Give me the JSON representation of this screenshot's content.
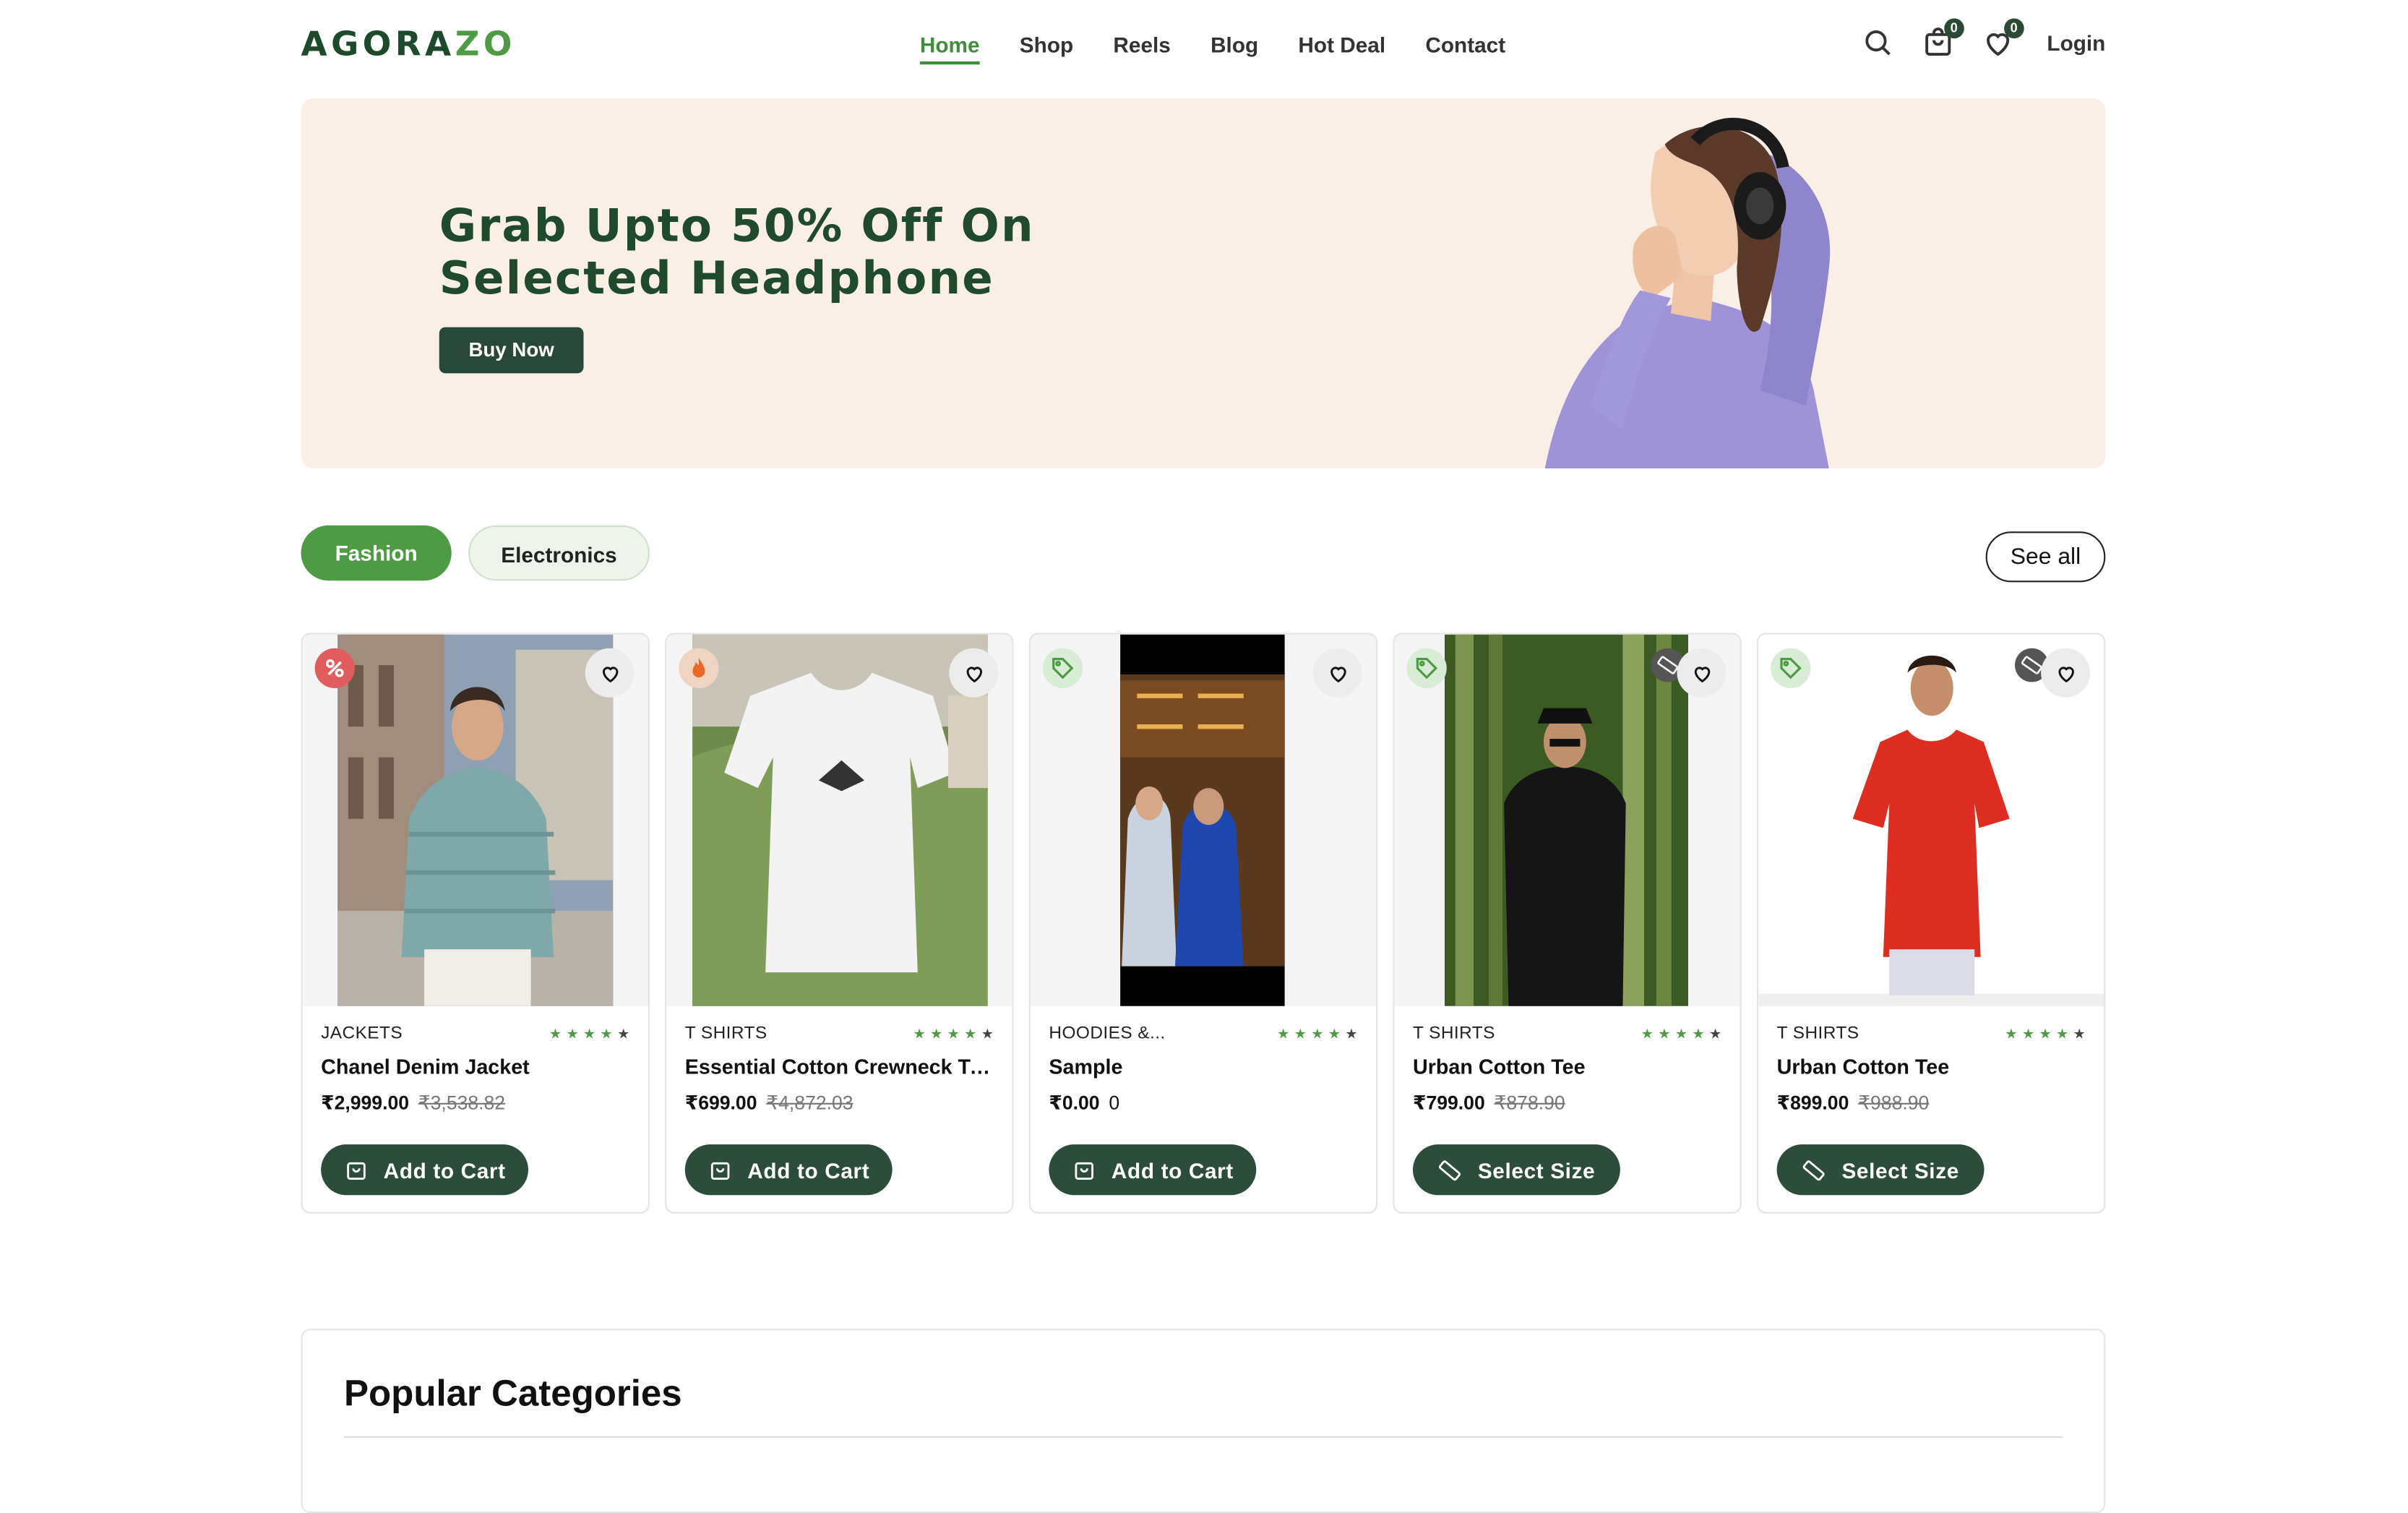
{
  "brand": {
    "logo_main": "AGORA",
    "logo_accent": "ZO",
    "primary_color": "#1e4a2c",
    "accent_color": "#4f9a44"
  },
  "nav": [
    {
      "label": "Home",
      "active": true
    },
    {
      "label": "Shop"
    },
    {
      "label": "Reels"
    },
    {
      "label": "Blog"
    },
    {
      "label": "Hot Deal"
    },
    {
      "label": "Contact"
    }
  ],
  "header": {
    "cart_count": "0",
    "wishlist_count": "0",
    "login_label": "Login"
  },
  "hero": {
    "title_line1": "Grab Upto 50% Off On",
    "title_line2": "Selected Headphone",
    "button_label": "Buy Now",
    "background_color": "#f9efe6"
  },
  "tabs": [
    {
      "label": "Fashion",
      "active": true
    },
    {
      "label": "Electronics"
    }
  ],
  "see_all_label": "See all",
  "stars_glyph": "★",
  "products": [
    {
      "category": "JACKETS",
      "name": "Chanel Denim Jacket",
      "price": "₹2,999.00",
      "old_price": "₹3,538.82",
      "button": "Add to Cart",
      "badge_icon": "percent-icon",
      "button_icon": "bag-icon"
    },
    {
      "category": "T SHIRTS",
      "name": "Essential Cotton Crewneck T-...",
      "price": "₹699.00",
      "old_price": "₹4,872.03",
      "button": "Add to Cart",
      "badge_icon": "flame-icon",
      "button_icon": "bag-icon"
    },
    {
      "category": "HOODIES &...",
      "name": "Sample",
      "price": "₹0.00",
      "old_price": "0",
      "button": "Add to Cart",
      "badge_icon": "tag-icon",
      "button_icon": "bag-icon"
    },
    {
      "category": "T SHIRTS",
      "name": "Urban Cotton Tee",
      "price": "₹799.00",
      "old_price": "₹878.90",
      "button": "Select Size",
      "badge_icon": "tag-icon",
      "button_icon": "ruler-icon"
    },
    {
      "category": "T SHIRTS",
      "name": "Urban Cotton Tee",
      "price": "₹899.00",
      "old_price": "₹988.90",
      "button": "Select Size",
      "badge_icon": "tag-icon",
      "button_icon": "ruler-icon"
    }
  ],
  "popular": {
    "title": "Popular Categories"
  }
}
